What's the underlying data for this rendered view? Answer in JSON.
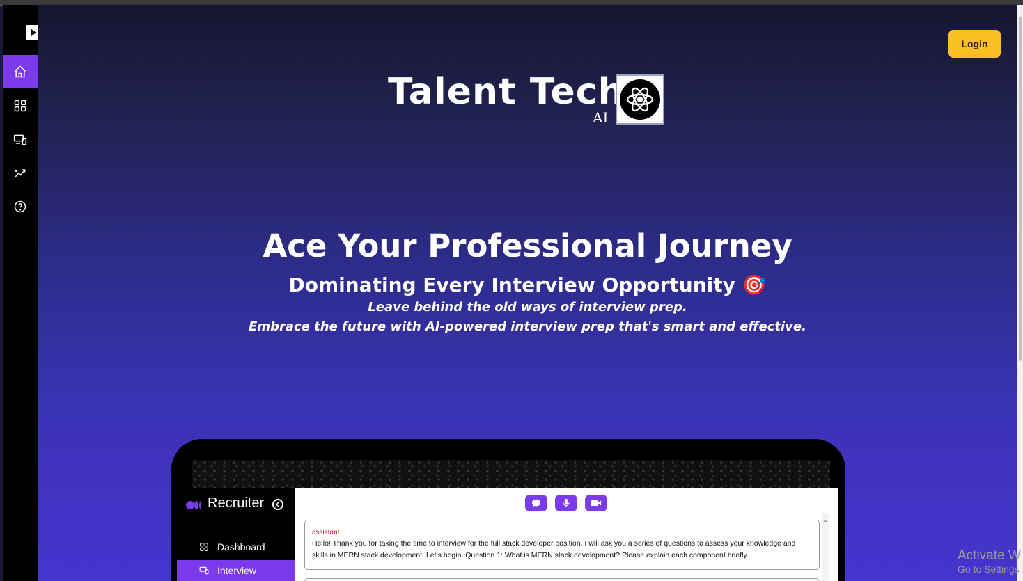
{
  "header": {
    "login_label": "Login"
  },
  "brand": {
    "name": "Talent Tech",
    "suffix": "AI"
  },
  "hero": {
    "title": "Ace Your Professional Journey",
    "subtitle": "Dominating Every Interview Opportunity 🎯",
    "line1": "Leave behind the old ways of interview prep.",
    "line2": "Embrace the future with AI-powered interview prep that's smart and effective."
  },
  "sidebar": {
    "items": [
      {
        "icon": "home-icon",
        "active": true
      },
      {
        "icon": "grid-icon",
        "active": false
      },
      {
        "icon": "devices-icon",
        "active": false
      },
      {
        "icon": "analytics-icon",
        "active": false
      },
      {
        "icon": "help-icon",
        "active": false
      }
    ]
  },
  "preview": {
    "app_title": "Recruiter",
    "nav": [
      {
        "label": "Dashboard",
        "icon": "grid-icon",
        "active": false
      },
      {
        "label": "Interview",
        "icon": "devices-icon",
        "active": true
      }
    ],
    "message": {
      "role": "assistant",
      "text": "Hello! Thank you for taking the time to interview for the full stack developer position. I will ask you a series of questions to assess your knowledge and skills in MERN stack development. Let's begin. Question 1: What is MERN stack development? Please explain each component briefly."
    }
  },
  "watermark": {
    "line1": "Activate W",
    "line2": "Go to Settings"
  },
  "colors": {
    "accent": "#7c3aed",
    "login": "#fbbf24"
  }
}
